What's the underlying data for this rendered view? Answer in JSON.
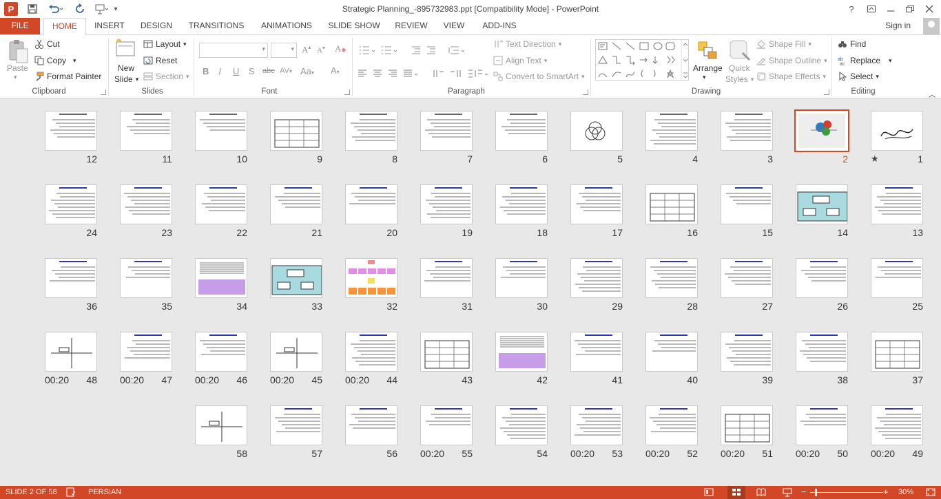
{
  "window": {
    "title": "Strategic Planning_-895732983.ppt [Compatibility Mode] - PowerPoint",
    "help": "?"
  },
  "tabs": {
    "file": "FILE",
    "items": [
      "HOME",
      "INSERT",
      "DESIGN",
      "TRANSITIONS",
      "ANIMATIONS",
      "SLIDE SHOW",
      "REVIEW",
      "VIEW",
      "ADD-INS"
    ],
    "sign_in": "Sign in"
  },
  "ribbon": {
    "clipboard": {
      "label": "Clipboard",
      "paste": "Paste",
      "cut": "Cut",
      "copy": "Copy",
      "format_painter": "Format Painter"
    },
    "slides": {
      "label": "Slides",
      "new_slide": "New",
      "new_slide2": "Slide",
      "layout": "Layout",
      "reset": "Reset",
      "section": "Section"
    },
    "font": {
      "label": "Font"
    },
    "paragraph": {
      "label": "Paragraph",
      "text_direction": "Text Direction",
      "align_text": "Align Text",
      "smartart": "Convert to SmartArt"
    },
    "drawing": {
      "label": "Drawing",
      "arrange": "Arrange",
      "quick_styles": "Quick",
      "quick_styles2": "Styles",
      "shape_fill": "Shape Fill",
      "shape_outline": "Shape Outline",
      "shape_effects": "Shape Effects"
    },
    "editing": {
      "label": "Editing",
      "find": "Find",
      "replace": "Replace",
      "select": "Select"
    }
  },
  "slides": [
    {
      "n": "1",
      "star": "★"
    },
    {
      "n": "2"
    },
    {
      "n": "3"
    },
    {
      "n": "4"
    },
    {
      "n": "5"
    },
    {
      "n": "6"
    },
    {
      "n": "7"
    },
    {
      "n": "8"
    },
    {
      "n": "9"
    },
    {
      "n": "10"
    },
    {
      "n": "11"
    },
    {
      "n": "12"
    },
    {
      "n": "13"
    },
    {
      "n": "14"
    },
    {
      "n": "15"
    },
    {
      "n": "16"
    },
    {
      "n": "17"
    },
    {
      "n": "18"
    },
    {
      "n": "19"
    },
    {
      "n": "20"
    },
    {
      "n": "21"
    },
    {
      "n": "22"
    },
    {
      "n": "23"
    },
    {
      "n": "24"
    },
    {
      "n": "25"
    },
    {
      "n": "26"
    },
    {
      "n": "27"
    },
    {
      "n": "28"
    },
    {
      "n": "29"
    },
    {
      "n": "30"
    },
    {
      "n": "31"
    },
    {
      "n": "32"
    },
    {
      "n": "33"
    },
    {
      "n": "34"
    },
    {
      "n": "35"
    },
    {
      "n": "36"
    },
    {
      "n": "37"
    },
    {
      "n": "38"
    },
    {
      "n": "39"
    },
    {
      "n": "40"
    },
    {
      "n": "41"
    },
    {
      "n": "42"
    },
    {
      "n": "43"
    },
    {
      "n": "44",
      "time": "00:20"
    },
    {
      "n": "45",
      "time": "00:20"
    },
    {
      "n": "46",
      "time": "00:20"
    },
    {
      "n": "47",
      "time": "00:20"
    },
    {
      "n": "48",
      "time": "00:20"
    },
    {
      "n": "49",
      "time": "00:20"
    },
    {
      "n": "50",
      "time": "00:20"
    },
    {
      "n": "51",
      "time": "00:20"
    },
    {
      "n": "52",
      "time": "00:20"
    },
    {
      "n": "53",
      "time": "00:20"
    },
    {
      "n": "54"
    },
    {
      "n": "55",
      "time": "00:20"
    },
    {
      "n": "56"
    },
    {
      "n": "57"
    },
    {
      "n": "58"
    }
  ],
  "selected_slide": "2",
  "status": {
    "slide_info": "SLIDE 2 OF 58",
    "language": "PERSIAN",
    "zoom": "30%",
    "minus": "−",
    "plus": "+"
  },
  "colors": {
    "accent": "#d24726"
  }
}
